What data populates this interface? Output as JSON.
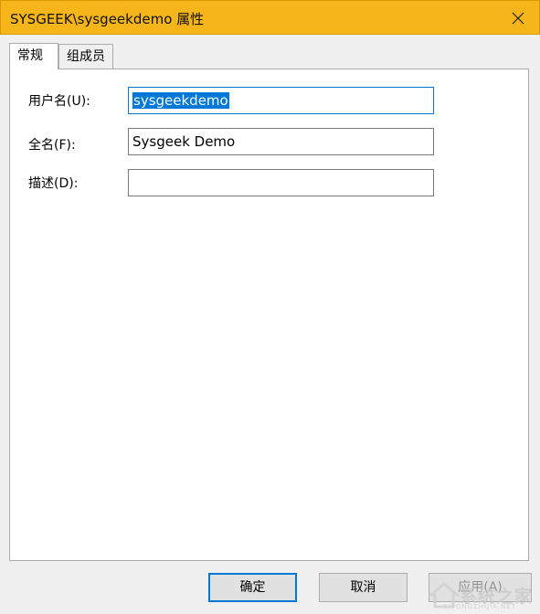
{
  "window": {
    "title": "SYSGEEK\\sysgeekdemo 属性",
    "close_glyph": "✕"
  },
  "tabs": [
    {
      "label": "常规"
    },
    {
      "label": "组成员"
    }
  ],
  "form": {
    "username_label": "用户名(U):",
    "username_value": "sysgeekdemo",
    "fullname_label": "全名(F):",
    "fullname_value": "Sysgeek Demo",
    "description_label": "描述(D):",
    "description_value": ""
  },
  "buttons": {
    "ok": "确定",
    "cancel": "取消",
    "apply": "应用(A)"
  },
  "watermark": {
    "text": "系统之家",
    "sub": "XITONGZHIJIA.NET"
  },
  "colors": {
    "titlebar": "#f6b518",
    "accent": "#0078d7"
  }
}
